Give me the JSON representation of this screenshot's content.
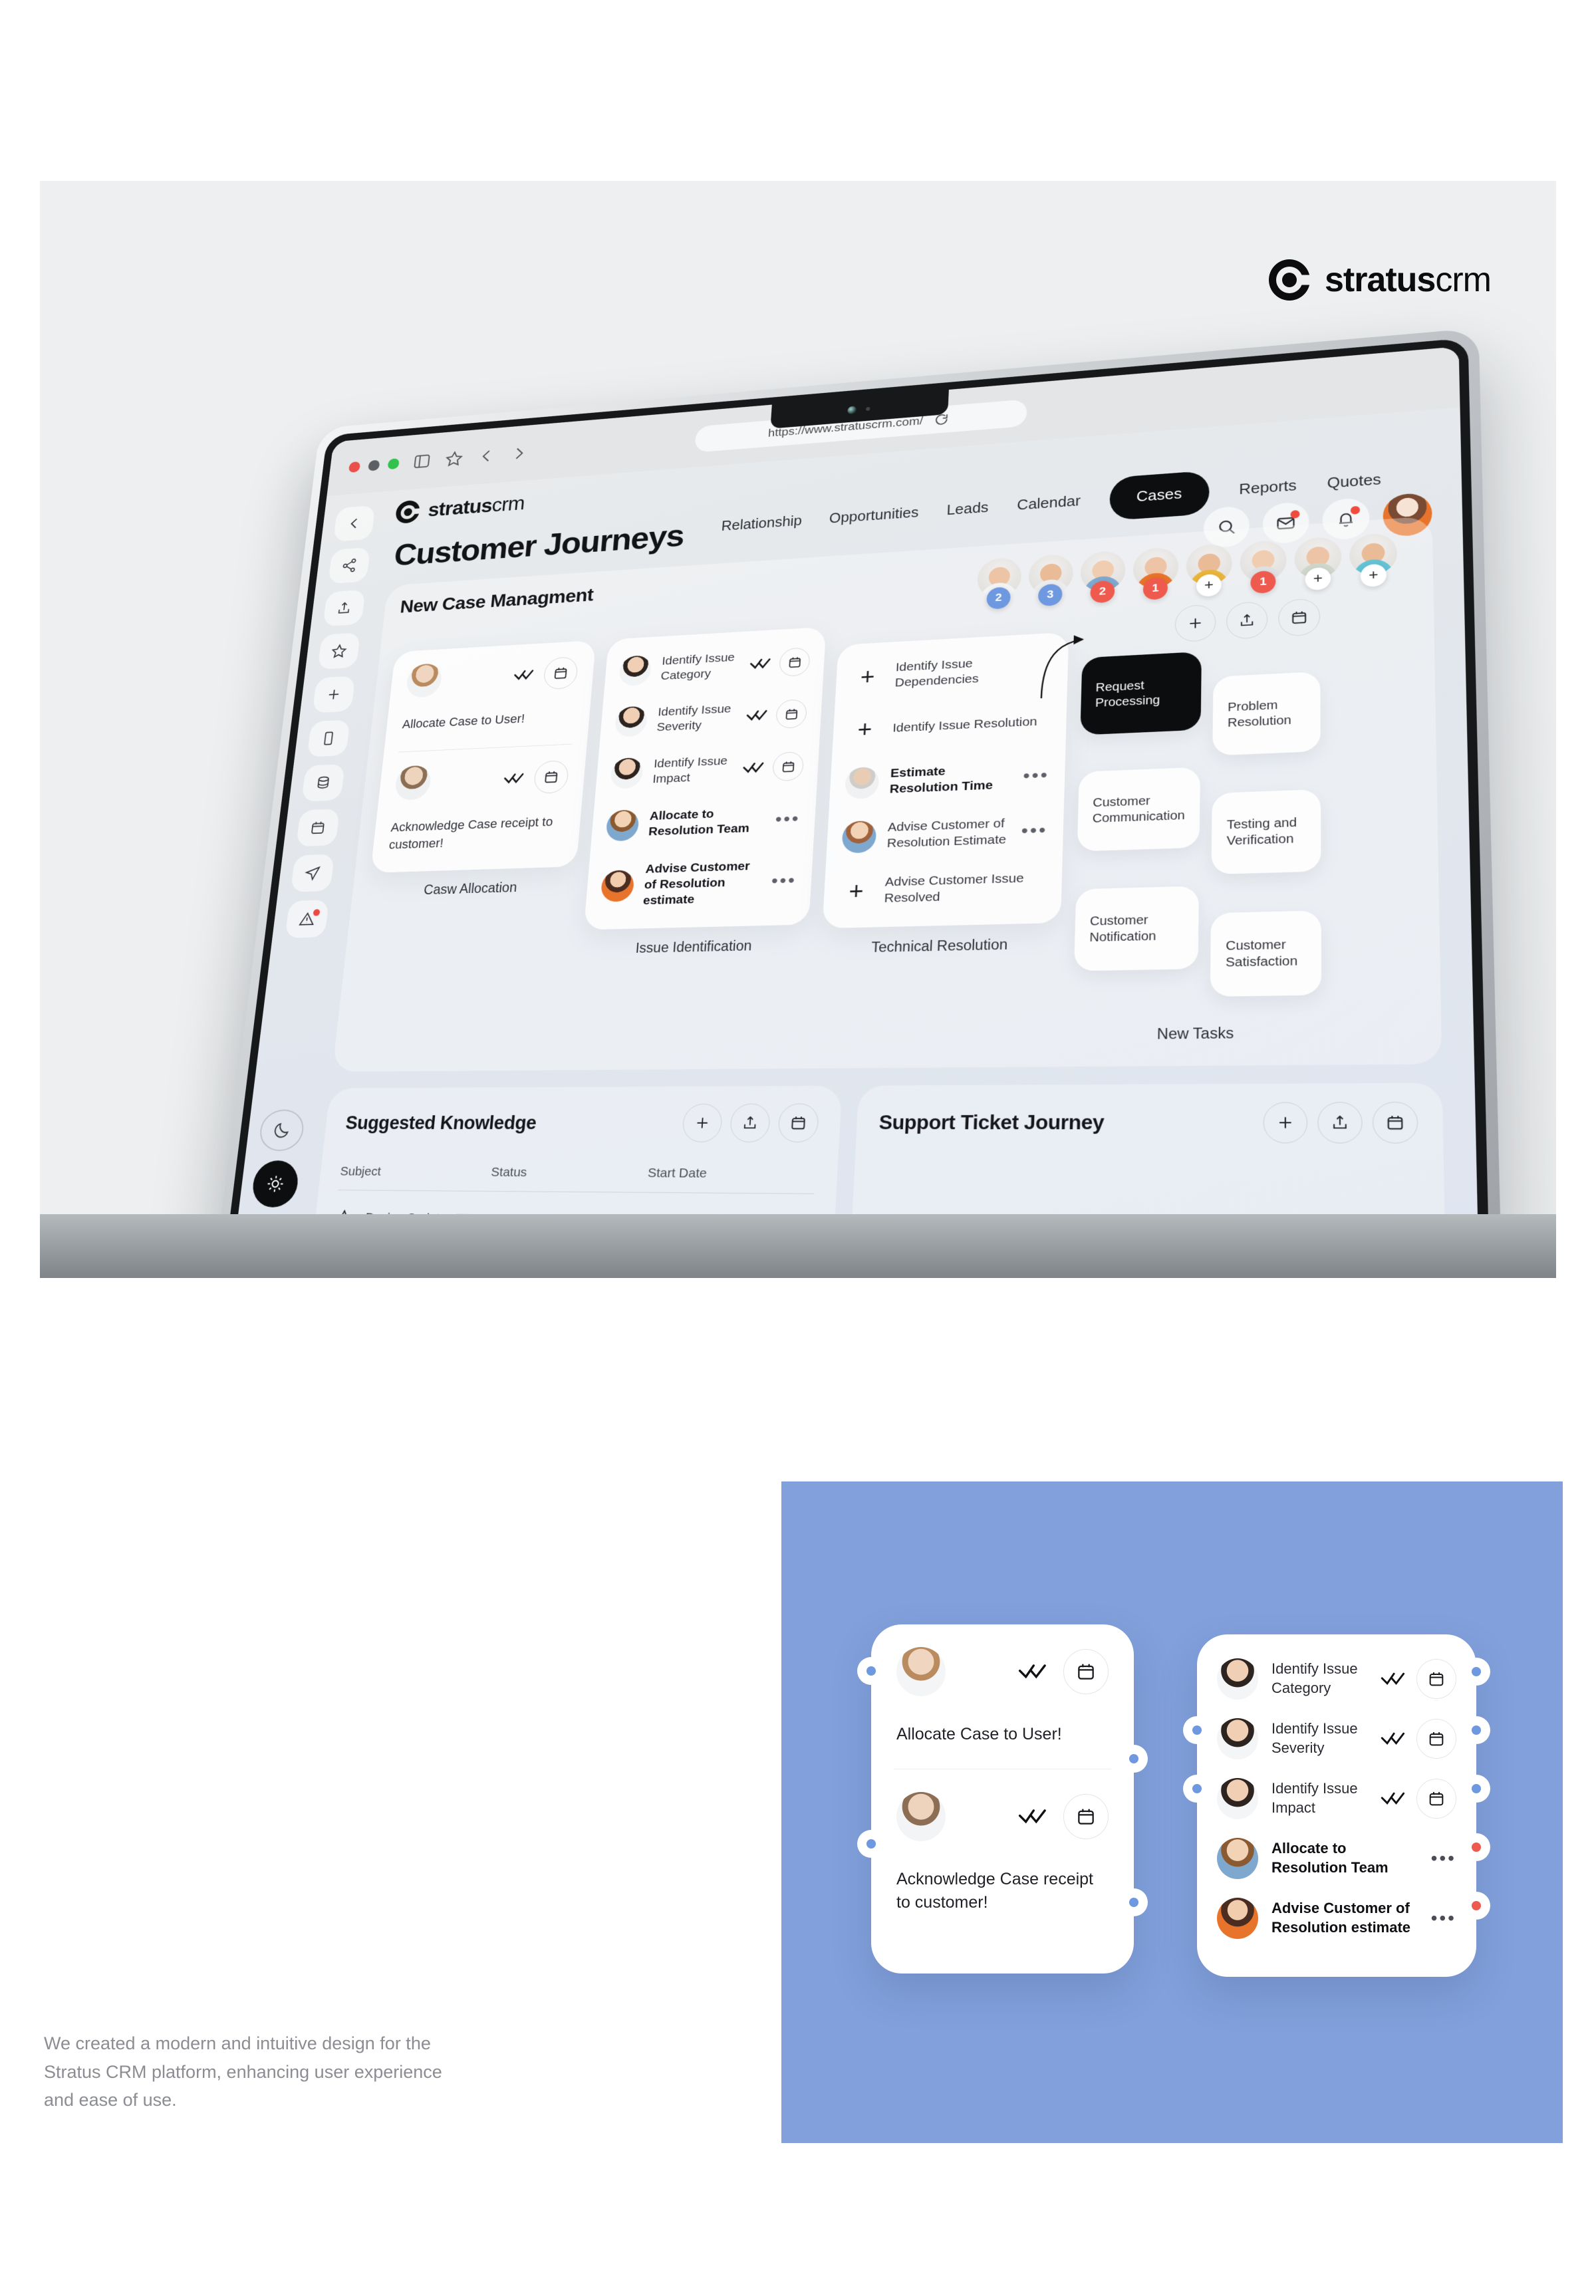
{
  "brand": {
    "name_bold": "stratus",
    "name_light": "crm"
  },
  "browser": {
    "url": "https://www.stratuscrm.com/",
    "icons": [
      "sidebar-toggle-icon",
      "bookmark-star-icon",
      "back-chevron-icon",
      "forward-chevron-icon",
      "reload-icon"
    ]
  },
  "app": {
    "page_title": "Customer Journeys",
    "nav": [
      {
        "label": "Relationship",
        "active": false
      },
      {
        "label": "Opportunities",
        "active": false
      },
      {
        "label": "Leads",
        "active": false
      },
      {
        "label": "Calendar",
        "active": false
      },
      {
        "label": "Cases",
        "active": true
      },
      {
        "label": "Reports",
        "active": false
      },
      {
        "label": "Quotes",
        "active": false
      }
    ],
    "rail": [
      "back-chevron-icon",
      "share-icon",
      "upload-icon",
      "star-icon",
      "plus-icon",
      "tablet-icon",
      "database-icon",
      "calendar-icon",
      "send-icon",
      "alert-icon"
    ],
    "theme_toggle": {
      "dark": "moon-icon",
      "light": "sun-icon",
      "active": "light"
    },
    "toolbar": [
      "search-icon",
      "mail-icon",
      "bell-icon",
      "user-avatar"
    ]
  },
  "board": {
    "title": "New Case Managment",
    "avatar_badges": [
      "2",
      "3",
      "2",
      "1",
      "+",
      "1",
      "+",
      "+"
    ],
    "avatar_badge_kinds": [
      "blue",
      "blue",
      "red",
      "red",
      "add",
      "red",
      "add",
      "add"
    ],
    "actions": [
      "add-icon",
      "upload-icon",
      "calendar-icon"
    ],
    "columns": [
      {
        "footer": "Casw Allocation",
        "cards": [
          {
            "label": "Allocate Case to User!",
            "status": "done"
          },
          {
            "label": "Acknowledge Case receipt to customer!",
            "status": "done"
          }
        ]
      },
      {
        "footer": "Issue Identification",
        "items": [
          {
            "label": "Identify Issue Category",
            "status": "done",
            "bold": false
          },
          {
            "label": "Identify Issue Severity",
            "status": "done",
            "bold": false
          },
          {
            "label": "Identify Issue Impact",
            "status": "done",
            "bold": false
          },
          {
            "label": "Allocate to Resolution Team",
            "status": "pending",
            "bold": true
          },
          {
            "label": "Advise Customer of Resolution estimate",
            "status": "pending",
            "bold": true
          }
        ]
      },
      {
        "footer": "Technical Resolution",
        "items": [
          {
            "label": "Identify Issue Dependencies",
            "status": "add",
            "bold": false
          },
          {
            "label": "Identify Issue Resolution",
            "status": "add",
            "bold": false
          },
          {
            "label": "Estimate Resolution Time",
            "status": "pending",
            "bold": true
          },
          {
            "label": "Advise Customer of Resolution Estimate",
            "status": "pending",
            "bold": false
          },
          {
            "label": "Advise Customer Issue Resolved",
            "status": "add",
            "bold": false
          }
        ]
      },
      {
        "footer": "New Tasks",
        "tiles": [
          {
            "label": "Request Processing",
            "dark": true
          },
          {
            "label": "Problem Resolution",
            "dark": false
          },
          {
            "label": "Customer Communication",
            "dark": false
          },
          {
            "label": "Testing and Verification",
            "dark": false
          },
          {
            "label": "Customer Notification",
            "dark": false
          },
          {
            "label": "Customer Satisfaction",
            "dark": false
          }
        ]
      }
    ]
  },
  "knowledge": {
    "title": "Suggested Knowledge",
    "actions": [
      "add-icon",
      "upload-icon",
      "calendar-icon"
    ],
    "headers": [
      "Subject",
      "Status",
      "Start Date"
    ],
    "rows": [
      {
        "subject": "Design Sprint",
        "status": "",
        "start_date": ""
      }
    ]
  },
  "support": {
    "title": "Support Ticket Journey",
    "actions": [
      "add-icon",
      "upload-icon",
      "calendar-icon"
    ]
  },
  "detail": {
    "left_card": [
      {
        "label": "Allocate Case to User!"
      },
      {
        "label": "Acknowledge Case receipt to customer!"
      }
    ],
    "right_card": [
      {
        "label": "Identify Issue Category",
        "status": "done",
        "bold": false
      },
      {
        "label": "Identify Issue Severity",
        "status": "done",
        "bold": false
      },
      {
        "label": "Identify Issue Impact",
        "status": "done",
        "bold": false
      },
      {
        "label": "Allocate to Resolution Team",
        "status": "pending",
        "bold": true
      },
      {
        "label": "Advise Customer of Resolution estimate",
        "status": "pending",
        "bold": true
      }
    ]
  },
  "caption": "We created a modern and intuitive design for the Stratus CRM platform, enhancing user experience and ease of use.",
  "colors": {
    "accent_blue": "#82a0db",
    "hero_bg": "#edeff0",
    "dark": "#0c0d0f",
    "badge_blue": "#6e98df",
    "badge_red": "#ef5a4f",
    "chip_blue": "#5b8ae0"
  }
}
